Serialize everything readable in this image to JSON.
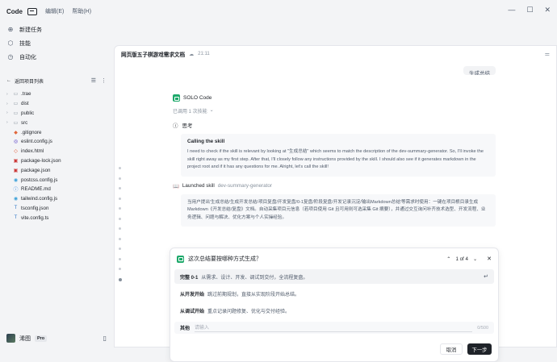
{
  "titlebar": {
    "brand": "Code",
    "menu": [
      "编辑(E)",
      "帮助(H)"
    ]
  },
  "sidebar": {
    "nav": [
      {
        "label": "新建任务",
        "icon": "chat-plus-icon"
      },
      {
        "label": "技能",
        "icon": "cube-icon"
      },
      {
        "label": "自动化",
        "icon": "clock-icon"
      }
    ],
    "back_label": "返回项目列表",
    "files": [
      {
        "name": ".trae",
        "type": "folder"
      },
      {
        "name": "dist",
        "type": "folder"
      },
      {
        "name": "public",
        "type": "folder"
      },
      {
        "name": "src",
        "type": "folder"
      },
      {
        "name": ".gitignore",
        "type": "git"
      },
      {
        "name": "eslint.config.js",
        "type": "eslint"
      },
      {
        "name": "index.html",
        "type": "html"
      },
      {
        "name": "package-lock.json",
        "type": "npm"
      },
      {
        "name": "package.json",
        "type": "npm"
      },
      {
        "name": "postcss.config.js",
        "type": "js"
      },
      {
        "name": "README.md",
        "type": "md"
      },
      {
        "name": "tailwind.config.js",
        "type": "js"
      },
      {
        "name": "tsconfig.json",
        "type": "ts"
      },
      {
        "name": "vite.config.ts",
        "type": "ts"
      }
    ],
    "user": {
      "name": "浠图",
      "plan": "Pro"
    }
  },
  "document": {
    "title": "网页版五子棋游戏需求文档",
    "time": "21:11"
  },
  "chat": {
    "user_bubble": "生成总结",
    "agent_name": "SOLO Code",
    "skills_used": "已调用 1 次技能",
    "thinking_label": "思考",
    "thinking_title": "Calling the skill",
    "thinking_text": "I need to check if the skill is relevant by looking at \"生成总结\" which seems to match the description of the dev-summary-generator. So, I'll invoke the skill right away as my first step. After that, I'll closely follow any instructions provided by the skill. I should also see if it generates markdown in the project root and if it has any questions for me. Alright, let's call the skill!",
    "launched_label": "Launched skill",
    "launched_skill": "dev-summary-generator",
    "launched_text": "当用户提出'生成总结/生成开发总结/项目复盘/开发复盘/0-1复盘/阶段复盘/开发记录沉淀/输出Markdown总结'等需求时使用：一键在项目根目录生成 Markdown《开发总结/复盘》文档。自动采集项目元信息（若项目使用 Git 且可用则可选采集 Git 摘要），并通过交互询问补齐技术选型、开发流程、业务逻辑、问题与解决、优化方案与个人实操经验。"
  },
  "question": {
    "prompt": "这次总结要按哪种方式生成？",
    "page": "1 of 4",
    "options": [
      {
        "title": "完整 0-1",
        "desc": "从需求、设计、开发、调试到交付，全流程复盘。"
      },
      {
        "title": "从开发开始",
        "desc": "跳过前期规划，直接从实现阶段开始总结。"
      },
      {
        "title": "从调试开始",
        "desc": "重点记录问题修复、优化与交付经验。"
      }
    ],
    "other_label": "其他",
    "other_placeholder": "请输入",
    "other_count": "0/500",
    "cancel_label": "取消",
    "next_label": "下一步"
  }
}
